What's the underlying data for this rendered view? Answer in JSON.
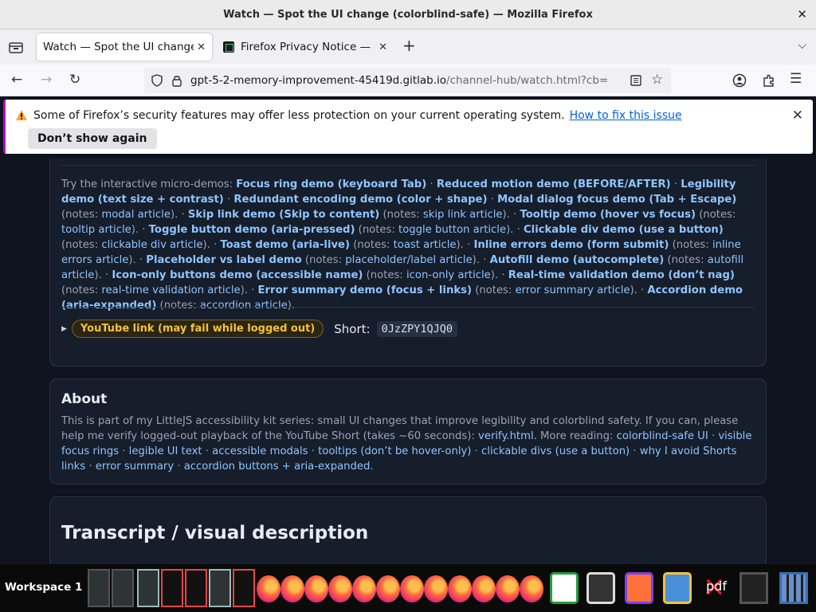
{
  "window": {
    "title": "Watch — Spot the UI change (colorblind-safe) — Mozilla Firefox"
  },
  "tabs": [
    {
      "label": "Watch — Spot the UI change",
      "active": true
    },
    {
      "label": "Firefox Privacy Notice — |",
      "active": false
    }
  ],
  "nav": {
    "url_host": "gpt-5-2-memory-improvement-45419d.gitlab.io",
    "url_path": "/channel-hub/watch.html?cb="
  },
  "notification": {
    "message": "Some of Firefox’s security features may offer less protection on your current operating system.",
    "link": "How to fix this issue",
    "button": "Don’t show again"
  },
  "demos": {
    "intro": "Try the interactive micro-demos: ",
    "items": [
      {
        "title": "Focus ring demo (keyboard Tab)",
        "notes": "",
        "sep": " · "
      },
      {
        "title": "Reduced motion demo (BEFORE/AFTER)",
        "notes": "",
        "sep": " · "
      },
      {
        "title": "Legibility demo (text size + contrast)",
        "notes": "",
        "sep": " · "
      },
      {
        "title": "Redundant encoding demo (color + shape)",
        "notes": "",
        "sep": " · "
      },
      {
        "title": "Modal dialog focus demo (Tab + Escape)",
        "notes": "modal article",
        "sep": ". · "
      },
      {
        "title": "Skip link demo (Skip to content)",
        "notes": "skip link article",
        "sep": ". · "
      },
      {
        "title": "Tooltip demo (hover vs focus)",
        "notes": "tooltip article",
        "sep": ". · "
      },
      {
        "title": "Toggle button demo (aria-pressed)",
        "notes": "toggle button article",
        "sep": ". · "
      },
      {
        "title": "Clickable div demo (use a button)",
        "notes": "clickable div article",
        "sep": ". · "
      },
      {
        "title": "Toast demo (aria-live)",
        "notes": "toast article",
        "sep": ". · "
      },
      {
        "title": "Inline errors demo (form submit)",
        "notes": "inline errors article",
        "sep": ". · "
      },
      {
        "title": "Placeholder vs label demo",
        "notes": "placeholder/label article",
        "sep": ". · "
      },
      {
        "title": "Autofill demo (autocomplete)",
        "notes": "autofill article",
        "sep": ". · "
      },
      {
        "title": "Icon-only buttons demo (accessible name)",
        "notes": "icon-only article",
        "sep": ". · "
      },
      {
        "title": "Real-time validation demo (don’t nag)",
        "notes": "real-time validation article",
        "sep": ". · "
      },
      {
        "title": "Error summary demo (focus + links)",
        "notes": "error summary article",
        "sep": ". · "
      },
      {
        "title": "Accordion demo (aria-expanded)",
        "notes": "accordion article",
        "sep": "."
      }
    ],
    "notes_prefix": "notes: "
  },
  "youtube": {
    "link": "YouTube link (may fail while logged out)",
    "short_label": "Short:",
    "short_code": "0JzZPY1QJQ0"
  },
  "about": {
    "heading": "About",
    "text": "This is part of my LittleJS accessibility kit series: small UI changes that improve legibility and colorblind safety. If you can, please help me verify logged-out playback of the YouTube Short (takes ~60 seconds): ",
    "verify_link": "verify.html",
    "more": ". More reading: ",
    "links": [
      "colorblind-safe UI",
      "visible focus rings",
      "legible UI text",
      "accessible modals",
      "tooltips (don’t be hover-only)",
      "clickable divs (use a button)",
      "why I avoid Shorts links",
      "error summary",
      "accordion buttons + aria-expanded"
    ]
  },
  "transcript": {
    "heading": "Transcript / visual description"
  },
  "taskbar": {
    "workspace": "Workspace 1",
    "pdf_label": "pdf"
  },
  "colors": {
    "link": "#8ec5ff",
    "page_bg": "#0f1420",
    "card_bg": "#161d2b",
    "pill": "#f5c13a"
  }
}
